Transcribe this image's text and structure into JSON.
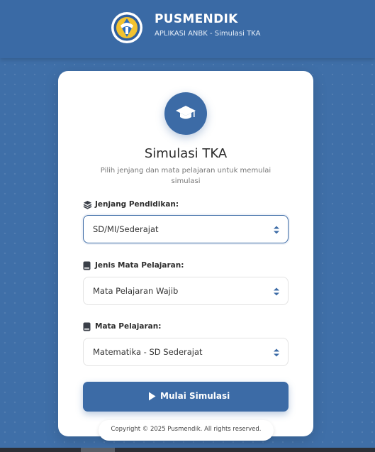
{
  "header": {
    "title": "PUSMENDIK",
    "subtitle": "APLIKASI ANBK - Simulasi TKA",
    "logo_icon": "kemendikbud-logo-icon"
  },
  "card": {
    "icon": "graduation-cap-icon",
    "title": "Simulasi TKA",
    "subtitle": "Pilih jenjang dan mata pelajaran untuk memulai simulasi"
  },
  "fields": [
    {
      "label": "Jenjang Pendidikan:",
      "icon": "layers-icon",
      "value": "SD/MI/Sederajat"
    },
    {
      "label": "Jenis Mata Pelajaran:",
      "icon": "book-icon",
      "value": "Mata Pelajaran Wajib"
    },
    {
      "label": "Mata Pelajaran:",
      "icon": "book-icon",
      "value": "Matematika - SD Sederajat"
    }
  ],
  "start_button": {
    "label": "Mulai Simulasi",
    "icon": "play-icon"
  },
  "footer": {
    "text": "Copyright © 2025 Pusmendik. All rights reserved."
  },
  "colors": {
    "primary": "#3c6ba6",
    "background": "#3f6fa8",
    "card": "#ffffff"
  }
}
